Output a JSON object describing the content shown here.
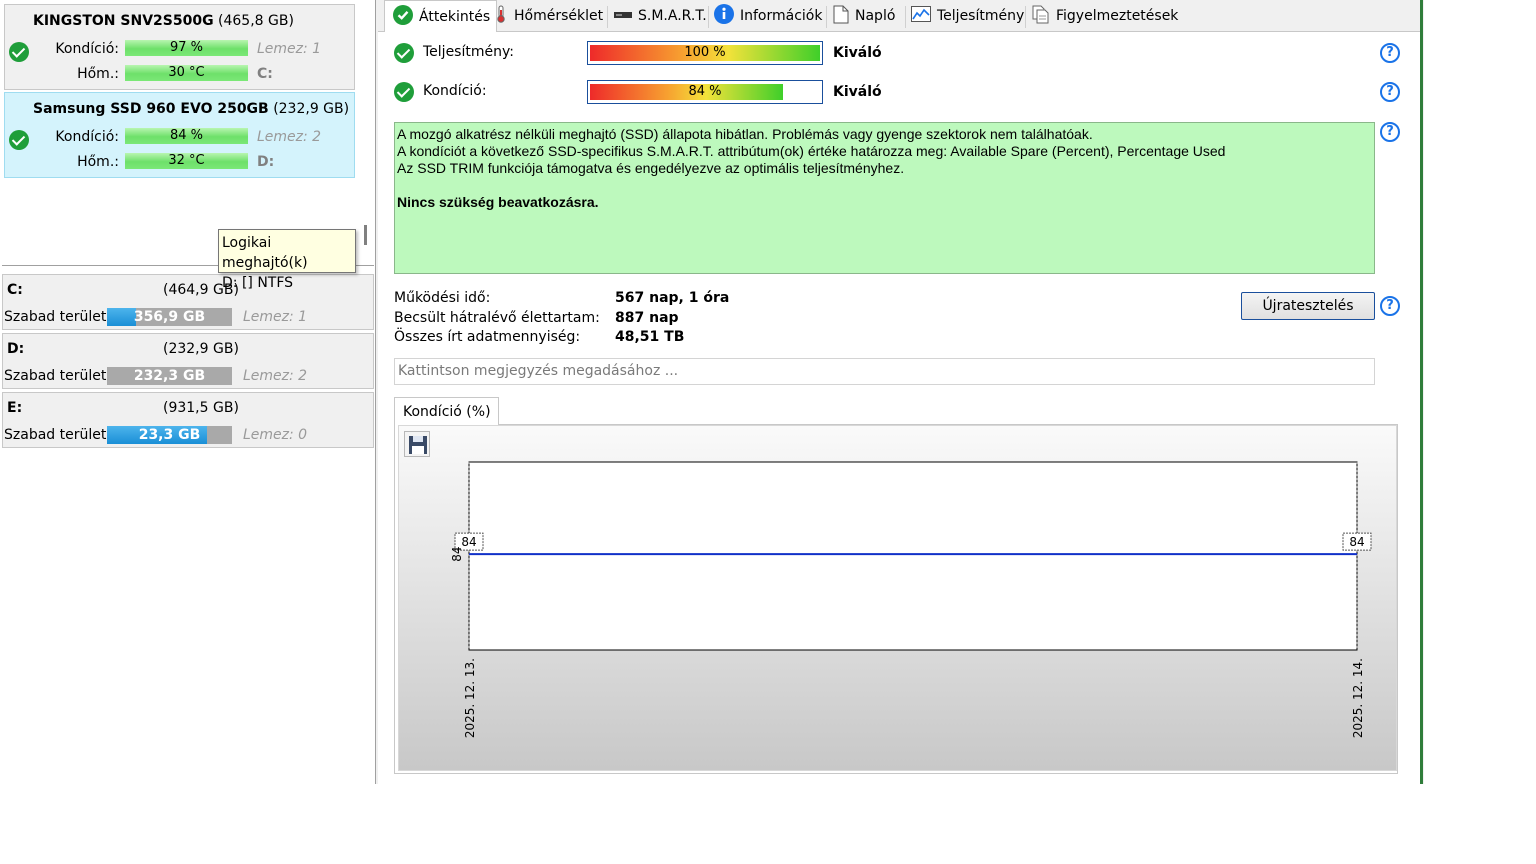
{
  "disks": [
    {
      "name": "KINGSTON SNV2S500G",
      "capacity": "(465,8 GB)",
      "health_label": "Kondíció:",
      "health": "97 %",
      "temp_label": "Hőm.:",
      "temp": "30 °C",
      "disk": "Lemez: 1",
      "drive": "C:"
    },
    {
      "name": "Samsung SSD 960 EVO 250GB",
      "capacity": "(232,9 GB)",
      "health_label": "Kondíció:",
      "health": "84 %",
      "temp_label": "Hőm.:",
      "temp": "32 °C",
      "disk": "Lemez: 2",
      "drive": "D:"
    }
  ],
  "tooltip": {
    "line1": "Logikai meghajtó(k)",
    "line2": "D: [] NTFS"
  },
  "volumes": [
    {
      "letter": "C:",
      "capacity": "(464,9 GB)",
      "free_label": "Szabad terület",
      "free": "356,9 GB",
      "free_fraction": 0.23,
      "disk": "Lemez: 1"
    },
    {
      "letter": "D:",
      "capacity": "(232,9 GB)",
      "free_label": "Szabad terület",
      "free": "232,3 GB",
      "free_fraction": 0.0,
      "disk": "Lemez: 2"
    },
    {
      "letter": "E:",
      "capacity": "(931,5 GB)",
      "free_label": "Szabad terület",
      "free": "23,3 GB",
      "free_fraction": 0.8,
      "disk": "Lemez: 0"
    }
  ],
  "tabs": [
    {
      "label": "Áttekintés",
      "icon": "check-circle-icon"
    },
    {
      "label": "Hőmérséklet",
      "icon": "thermometer-icon"
    },
    {
      "label": "S.M.A.R.T.",
      "icon": "drive-icon"
    },
    {
      "label": "Információk",
      "icon": "info-icon"
    },
    {
      "label": "Napló",
      "icon": "document-icon"
    },
    {
      "label": "Teljesítmény",
      "icon": "performance-chart-icon"
    },
    {
      "label": "Figyelmeztetések",
      "icon": "alerts-icon"
    }
  ],
  "overview": {
    "performance_label": "Teljesítmény:",
    "performance_value": "100 %",
    "performance_percent": 100,
    "performance_grade": "Kiváló",
    "health_label": "Kondíció:",
    "health_value": "84 %",
    "health_percent": 84,
    "health_grade": "Kiváló",
    "message_lines": [
      "A mozgó alkatrész nélküli meghajtó (SSD) állapota hibátlan. Problémás vagy gyenge szektorok nem találhatóak.",
      "A kondíciót a következő SSD-specifikus S.M.A.R.T. attribútum(ok) értéke határozza meg:  Available Spare (Percent), Percentage Used",
      "Az SSD TRIM funkciója támogatva és engedélyezve az optimális teljesítményhez."
    ],
    "message_bold": "Nincs szükség beavatkozásra.",
    "uptime_label": "Működési idő:",
    "uptime_value": "567 nap, 1 óra",
    "remaining_label": "Becsült hátralévő élettartam:",
    "remaining_value": "887 nap",
    "written_label": "Összes írt adatmennyiség:",
    "written_value": "48,51 TB",
    "retest_label": "Újratesztelés",
    "note_placeholder": "Kattintson megjegyzés megadásához ...",
    "help_symbol": "?"
  },
  "chart_tab_label": "Kondíció  (%)",
  "colors": {
    "accent": "#1a73e8",
    "ok_green": "#1f9e3a",
    "message_bg": "#bdf9bd",
    "line": "#1030c8"
  },
  "chart_data": {
    "type": "line",
    "x": [
      "2025. 12. 13.",
      "2025. 12. 14."
    ],
    "series": [
      {
        "values": [
          84,
          84
        ]
      }
    ],
    "data_labels": [
      "84",
      "84"
    ],
    "y_tick_labels": [
      "84"
    ],
    "ylim": [
      84,
      84
    ],
    "grid": false
  }
}
